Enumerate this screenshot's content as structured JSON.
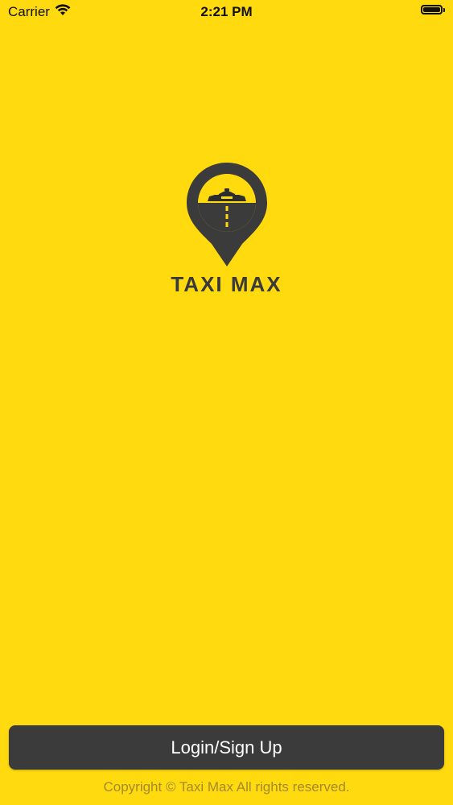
{
  "status_bar": {
    "carrier": "Carrier",
    "time": "2:21 PM",
    "icons": [
      "wifi-icon",
      "battery-icon"
    ]
  },
  "logo": {
    "text": "TAXI MAX",
    "pin_color": "#3b3b3b",
    "accent_color": "#FFDA0F"
  },
  "actions": {
    "login_label": "Login/Sign Up"
  },
  "footer": {
    "copyright": "Copyright © Taxi Max All rights reserved."
  },
  "colors": {
    "background": "#FFDA0F",
    "button": "#3b3b3b",
    "copyright_text": "#a38a2c"
  }
}
